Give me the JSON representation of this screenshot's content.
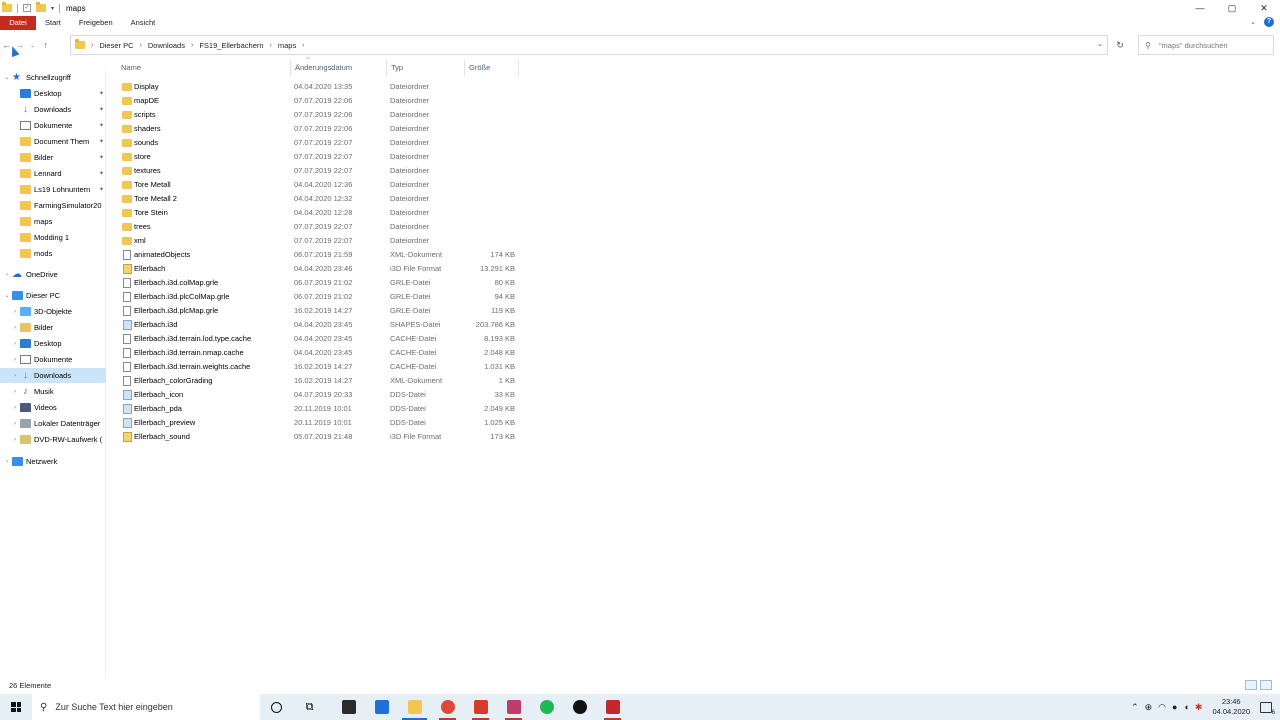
{
  "window": {
    "title": "maps",
    "controls": {
      "minimize": "—",
      "maximize": "▢",
      "close": "✕"
    }
  },
  "ribbon": {
    "tabs": [
      "Datei",
      "Start",
      "Freigeben",
      "Ansicht"
    ]
  },
  "address": {
    "crumbs": [
      "Dieser PC",
      "Downloads",
      "FS19_Ellerbachern",
      "maps"
    ],
    "search_placeholder": "\"maps\" durchsuchen"
  },
  "nav": {
    "quick_access_label": "Schnellzugriff",
    "quick_items": [
      {
        "label": "Desktop",
        "icon": "blue",
        "pinned": true
      },
      {
        "label": "Downloads",
        "icon": "dl",
        "pinned": true
      },
      {
        "label": "Dokumente",
        "icon": "doc",
        "pinned": true
      },
      {
        "label": "Document Them",
        "icon": "folder",
        "pinned": true
      },
      {
        "label": "Bilder",
        "icon": "folder",
        "pinned": true
      },
      {
        "label": "Lennard",
        "icon": "folder",
        "pinned": true
      },
      {
        "label": "Ls19 Lohnuntern",
        "icon": "folder",
        "pinned": true
      },
      {
        "label": "FarmingSimulator20",
        "icon": "folder",
        "pinned": false
      },
      {
        "label": "maps",
        "icon": "folder",
        "pinned": false
      },
      {
        "label": "Modding 1",
        "icon": "folder",
        "pinned": false
      },
      {
        "label": "mods",
        "icon": "folder",
        "pinned": false
      }
    ],
    "onedrive_label": "OneDrive",
    "this_pc_label": "Dieser PC",
    "pc_items": [
      {
        "label": "3D-Objekte",
        "icon": "obj"
      },
      {
        "label": "Bilder",
        "icon": "img"
      },
      {
        "label": "Desktop",
        "icon": "blue"
      },
      {
        "label": "Dokumente",
        "icon": "doc"
      },
      {
        "label": "Downloads",
        "icon": "dl",
        "selected": true
      },
      {
        "label": "Musik",
        "icon": "music"
      },
      {
        "label": "Videos",
        "icon": "vid"
      },
      {
        "label": "Lokaler Datenträger",
        "icon": "drive"
      },
      {
        "label": "DVD-RW-Laufwerk (",
        "icon": "dvd"
      }
    ],
    "network_label": "Netzwerk"
  },
  "columns": {
    "name": "Name",
    "date": "Änderungsdatum",
    "type": "Typ",
    "size": "Größe"
  },
  "files": [
    {
      "name": "Display",
      "date": "04.04.2020 13:35",
      "type": "Dateiordner",
      "size": "",
      "icon": "folder"
    },
    {
      "name": "mapDE",
      "date": "07.07.2019 22:06",
      "type": "Dateiordner",
      "size": "",
      "icon": "folder"
    },
    {
      "name": "scripts",
      "date": "07.07.2019 22:06",
      "type": "Dateiordner",
      "size": "",
      "icon": "folder"
    },
    {
      "name": "shaders",
      "date": "07.07.2019 22:06",
      "type": "Dateiordner",
      "size": "",
      "icon": "folder"
    },
    {
      "name": "sounds",
      "date": "07.07.2019 22:07",
      "type": "Dateiordner",
      "size": "",
      "icon": "folder"
    },
    {
      "name": "store",
      "date": "07.07.2019 22:07",
      "type": "Dateiordner",
      "size": "",
      "icon": "folder"
    },
    {
      "name": "textures",
      "date": "07.07.2019 22:07",
      "type": "Dateiordner",
      "size": "",
      "icon": "folder"
    },
    {
      "name": "Tore Metall",
      "date": "04.04.2020 12:36",
      "type": "Dateiordner",
      "size": "",
      "icon": "folder"
    },
    {
      "name": "Tore Metall 2",
      "date": "04.04.2020 12:32",
      "type": "Dateiordner",
      "size": "",
      "icon": "folder"
    },
    {
      "name": "Tore Stein",
      "date": "04.04.2020 12:28",
      "type": "Dateiordner",
      "size": "",
      "icon": "folder"
    },
    {
      "name": "trees",
      "date": "07.07.2019 22:07",
      "type": "Dateiordner",
      "size": "",
      "icon": "folder"
    },
    {
      "name": "xml",
      "date": "07.07.2019 22:07",
      "type": "Dateiordner",
      "size": "",
      "icon": "folder"
    },
    {
      "name": "animatedObjects",
      "date": "06.07.2019 21:59",
      "type": "XML-Dokument",
      "size": "174 KB",
      "icon": "file"
    },
    {
      "name": "Ellerbach",
      "date": "04.04.2020 23:46",
      "type": "i3D File Format",
      "size": "13.291 KB",
      "icon": "i3d"
    },
    {
      "name": "Ellerbach.i3d.colMap.grle",
      "date": "06.07.2019 21:02",
      "type": "GRLE-Datei",
      "size": "80 KB",
      "icon": "file"
    },
    {
      "name": "Ellerbach.i3d.plcColMap.grle",
      "date": "06.07.2019 21:02",
      "type": "GRLE-Datei",
      "size": "94 KB",
      "icon": "file"
    },
    {
      "name": "Ellerbach.i3d.plcMap.grle",
      "date": "16.02.2019 14:27",
      "type": "GRLE-Datei",
      "size": "119 KB",
      "icon": "file"
    },
    {
      "name": "Ellerbach.i3d",
      "date": "04.04.2020 23:45",
      "type": "SHAPES-Datei",
      "size": "203.786 KB",
      "icon": "img"
    },
    {
      "name": "Ellerbach.i3d.terrain.lod.type.cache",
      "date": "04.04.2020 23:45",
      "type": "CACHE-Datei",
      "size": "8.193 KB",
      "icon": "file"
    },
    {
      "name": "Ellerbach.i3d.terrain.nmap.cache",
      "date": "04.04.2020 23:45",
      "type": "CACHE-Datei",
      "size": "2.048 KB",
      "icon": "file"
    },
    {
      "name": "Ellerbach.i3d.terrain.weights.cache",
      "date": "16.02.2019 14:27",
      "type": "CACHE-Datei",
      "size": "1.031 KB",
      "icon": "file"
    },
    {
      "name": "Ellerbach_colorGrading",
      "date": "16.02.2019 14:27",
      "type": "XML-Dokument",
      "size": "1 KB",
      "icon": "file"
    },
    {
      "name": "Ellerbach_icon",
      "date": "04.07.2019 20:33",
      "type": "DDS-Datei",
      "size": "33 KB",
      "icon": "img"
    },
    {
      "name": "Ellerbach_pda",
      "date": "20.11.2019 10:01",
      "type": "DDS-Datei",
      "size": "2.049 KB",
      "icon": "img"
    },
    {
      "name": "Ellerbach_preview",
      "date": "20.11.2019 10:01",
      "type": "DDS-Datei",
      "size": "1.025 KB",
      "icon": "img"
    },
    {
      "name": "Ellerbach_sound",
      "date": "05.07.2019 21:48",
      "type": "i3D File Format",
      "size": "173 KB",
      "icon": "i3d"
    }
  ],
  "status": {
    "count": "26 Elemente"
  },
  "taskbar": {
    "search_placeholder": "Zur Suche Text hier eingeben",
    "apps": [
      {
        "name": "store-icon",
        "color": "#2b2b2b"
      },
      {
        "name": "mail-icon",
        "color": "#1f6fd6"
      },
      {
        "name": "explorer-icon",
        "color": "#f2c650",
        "state": "active"
      },
      {
        "name": "chrome-icon",
        "color": "#e0483b",
        "state": "running"
      },
      {
        "name": "acrobat-icon",
        "color": "#d83a2a",
        "state": "running"
      },
      {
        "name": "discord-icon",
        "color": "#c03a6a",
        "state": "running"
      },
      {
        "name": "spotify-icon",
        "color": "#1db954"
      },
      {
        "name": "steam-icon",
        "color": "#111111"
      },
      {
        "name": "video-editor-icon",
        "color": "#c0282d",
        "state": "running"
      }
    ],
    "time": "23:46",
    "date": "04.04.2020"
  }
}
